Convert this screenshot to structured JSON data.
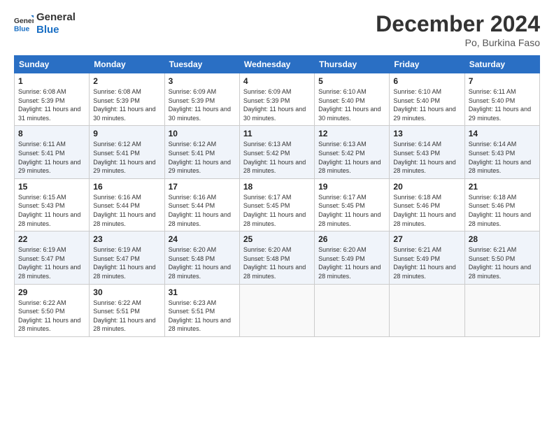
{
  "logo": {
    "line1": "General",
    "line2": "Blue"
  },
  "title": "December 2024",
  "location": "Po, Burkina Faso",
  "weekdays": [
    "Sunday",
    "Monday",
    "Tuesday",
    "Wednesday",
    "Thursday",
    "Friday",
    "Saturday"
  ],
  "weeks": [
    [
      {
        "day": "1",
        "sunrise": "6:08 AM",
        "sunset": "5:39 PM",
        "daylight": "11 hours and 31 minutes."
      },
      {
        "day": "2",
        "sunrise": "6:08 AM",
        "sunset": "5:39 PM",
        "daylight": "11 hours and 30 minutes."
      },
      {
        "day": "3",
        "sunrise": "6:09 AM",
        "sunset": "5:39 PM",
        "daylight": "11 hours and 30 minutes."
      },
      {
        "day": "4",
        "sunrise": "6:09 AM",
        "sunset": "5:39 PM",
        "daylight": "11 hours and 30 minutes."
      },
      {
        "day": "5",
        "sunrise": "6:10 AM",
        "sunset": "5:40 PM",
        "daylight": "11 hours and 30 minutes."
      },
      {
        "day": "6",
        "sunrise": "6:10 AM",
        "sunset": "5:40 PM",
        "daylight": "11 hours and 29 minutes."
      },
      {
        "day": "7",
        "sunrise": "6:11 AM",
        "sunset": "5:40 PM",
        "daylight": "11 hours and 29 minutes."
      }
    ],
    [
      {
        "day": "8",
        "sunrise": "6:11 AM",
        "sunset": "5:41 PM",
        "daylight": "11 hours and 29 minutes."
      },
      {
        "day": "9",
        "sunrise": "6:12 AM",
        "sunset": "5:41 PM",
        "daylight": "11 hours and 29 minutes."
      },
      {
        "day": "10",
        "sunrise": "6:12 AM",
        "sunset": "5:41 PM",
        "daylight": "11 hours and 29 minutes."
      },
      {
        "day": "11",
        "sunrise": "6:13 AM",
        "sunset": "5:42 PM",
        "daylight": "11 hours and 28 minutes."
      },
      {
        "day": "12",
        "sunrise": "6:13 AM",
        "sunset": "5:42 PM",
        "daylight": "11 hours and 28 minutes."
      },
      {
        "day": "13",
        "sunrise": "6:14 AM",
        "sunset": "5:43 PM",
        "daylight": "11 hours and 28 minutes."
      },
      {
        "day": "14",
        "sunrise": "6:14 AM",
        "sunset": "5:43 PM",
        "daylight": "11 hours and 28 minutes."
      }
    ],
    [
      {
        "day": "15",
        "sunrise": "6:15 AM",
        "sunset": "5:43 PM",
        "daylight": "11 hours and 28 minutes."
      },
      {
        "day": "16",
        "sunrise": "6:16 AM",
        "sunset": "5:44 PM",
        "daylight": "11 hours and 28 minutes."
      },
      {
        "day": "17",
        "sunrise": "6:16 AM",
        "sunset": "5:44 PM",
        "daylight": "11 hours and 28 minutes."
      },
      {
        "day": "18",
        "sunrise": "6:17 AM",
        "sunset": "5:45 PM",
        "daylight": "11 hours and 28 minutes."
      },
      {
        "day": "19",
        "sunrise": "6:17 AM",
        "sunset": "5:45 PM",
        "daylight": "11 hours and 28 minutes."
      },
      {
        "day": "20",
        "sunrise": "6:18 AM",
        "sunset": "5:46 PM",
        "daylight": "11 hours and 28 minutes."
      },
      {
        "day": "21",
        "sunrise": "6:18 AM",
        "sunset": "5:46 PM",
        "daylight": "11 hours and 28 minutes."
      }
    ],
    [
      {
        "day": "22",
        "sunrise": "6:19 AM",
        "sunset": "5:47 PM",
        "daylight": "11 hours and 28 minutes."
      },
      {
        "day": "23",
        "sunrise": "6:19 AM",
        "sunset": "5:47 PM",
        "daylight": "11 hours and 28 minutes."
      },
      {
        "day": "24",
        "sunrise": "6:20 AM",
        "sunset": "5:48 PM",
        "daylight": "11 hours and 28 minutes."
      },
      {
        "day": "25",
        "sunrise": "6:20 AM",
        "sunset": "5:48 PM",
        "daylight": "11 hours and 28 minutes."
      },
      {
        "day": "26",
        "sunrise": "6:20 AM",
        "sunset": "5:49 PM",
        "daylight": "11 hours and 28 minutes."
      },
      {
        "day": "27",
        "sunrise": "6:21 AM",
        "sunset": "5:49 PM",
        "daylight": "11 hours and 28 minutes."
      },
      {
        "day": "28",
        "sunrise": "6:21 AM",
        "sunset": "5:50 PM",
        "daylight": "11 hours and 28 minutes."
      }
    ],
    [
      {
        "day": "29",
        "sunrise": "6:22 AM",
        "sunset": "5:50 PM",
        "daylight": "11 hours and 28 minutes."
      },
      {
        "day": "30",
        "sunrise": "6:22 AM",
        "sunset": "5:51 PM",
        "daylight": "11 hours and 28 minutes."
      },
      {
        "day": "31",
        "sunrise": "6:23 AM",
        "sunset": "5:51 PM",
        "daylight": "11 hours and 28 minutes."
      },
      null,
      null,
      null,
      null
    ]
  ]
}
